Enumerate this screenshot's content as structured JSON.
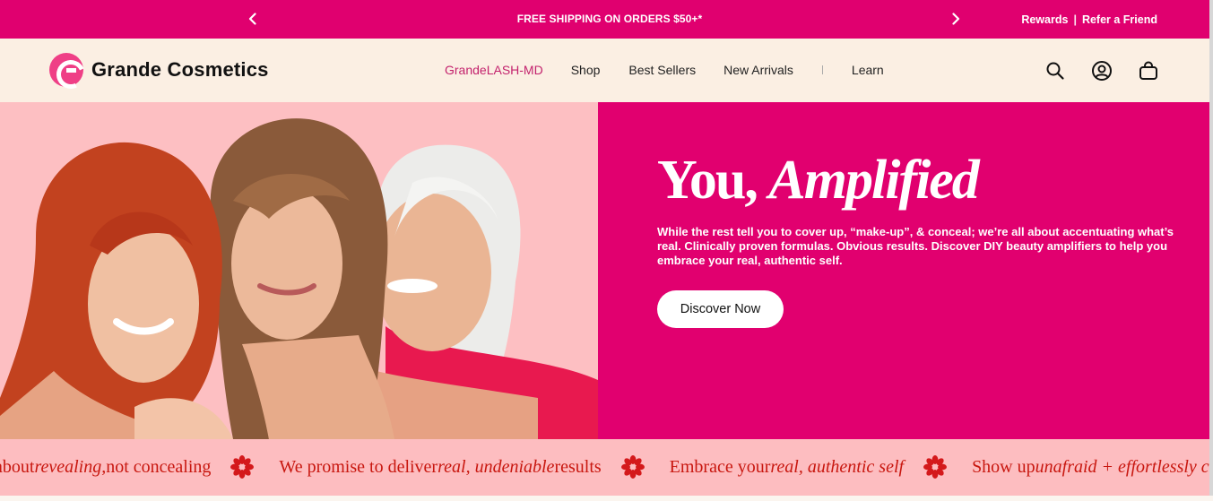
{
  "announcement": {
    "message": "FREE SHIPPING ON ORDERS $50+*",
    "prev_icon": "chevron-left-icon",
    "next_icon": "chevron-right-icon",
    "rewards_label": "Rewards",
    "separator": "|",
    "refer_label": "Refer a Friend",
    "bg_color": "#e0006f"
  },
  "header": {
    "brand": "Grande Cosmetics",
    "nav": [
      {
        "label": "GrandeLASH-MD",
        "active": true
      },
      {
        "label": "Shop"
      },
      {
        "label": "Best Sellers"
      },
      {
        "label": "New Arrivals"
      },
      {
        "label": "Learn"
      }
    ],
    "icons": [
      "search-icon",
      "account-icon",
      "bag-icon"
    ],
    "active_color": "#c3226d"
  },
  "hero": {
    "title_plain": "You,",
    "title_script": "Amplified",
    "description": "While the rest tell you to cover up, “make-up”, & conceal; we’re all about accentuating what’s real. Clinically proven formulas. Obvious results. Discover DIY beauty amplifiers to help you embrace your real, authentic self.",
    "cta_label": "Discover Now",
    "image_subject": "three smiling women with red, brown and white hair",
    "bg_color": "#e1006f"
  },
  "marquee": {
    "items": [
      {
        "pre": "about ",
        "italic": "revealing,",
        "post": " not concealing"
      },
      {
        "pre": "We promise to deliver ",
        "italic": "real, undeniable",
        "post": " results"
      },
      {
        "pre": "Embrace your ",
        "italic": "real, authentic self",
        "post": ""
      },
      {
        "pre": "Show up ",
        "italic": "unafraid + effortlessly confident",
        "post": ""
      }
    ],
    "separator_icon": "flower-icon",
    "text_color": "#c8170f"
  }
}
